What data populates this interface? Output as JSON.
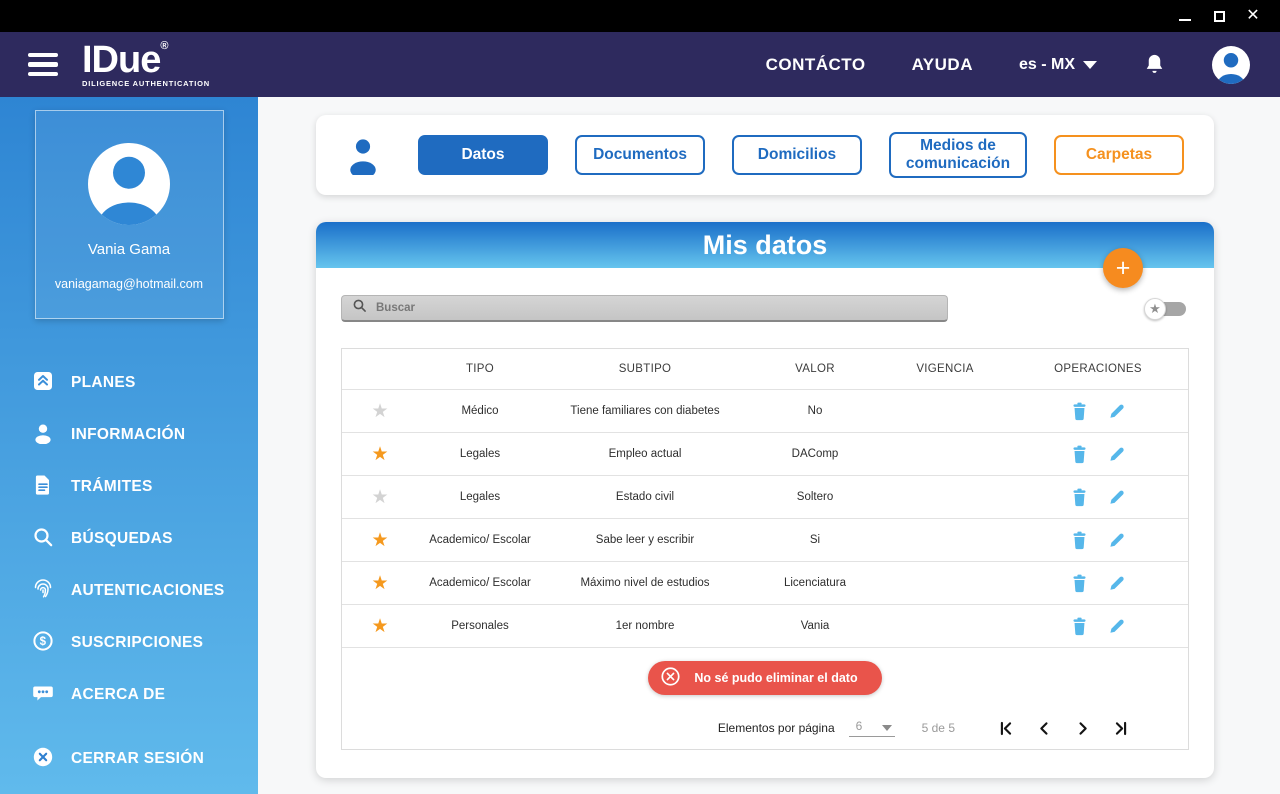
{
  "colors": {
    "header_bg": "#2e2a5e",
    "sidebar_top": "#2e85d3",
    "sidebar_bottom": "#60baec",
    "primary_blue": "#1f6bc0",
    "accent_orange": "#f5911e",
    "operation_icon_blue": "#56b7ea",
    "toast_red": "#e9544b",
    "panel_header_top": "#1a6fc9",
    "panel_header_bottom": "#66c5ee"
  },
  "header": {
    "logo": {
      "title": "IDue",
      "registered_mark": "®",
      "subtitle": "DILIGENCE AUTHENTICATION"
    },
    "nav": {
      "contacto": "CONTÁCTO",
      "ayuda": "AYUDA"
    },
    "language": {
      "value": "es - MX"
    },
    "icons": {
      "menu": "hamburger-icon",
      "notifications": "bell-icon",
      "profile": "avatar"
    }
  },
  "sidebar": {
    "user": {
      "name": "Vania Gama",
      "email": "vaniagamag@hotmail.com"
    },
    "items": [
      {
        "label": "PLANES",
        "icon": "plans-icon"
      },
      {
        "label": "INFORMACIÓN",
        "icon": "person-icon"
      },
      {
        "label": "TRÁMITES",
        "icon": "document-icon"
      },
      {
        "label": "BÚSQUEDAS",
        "icon": "search-icon"
      },
      {
        "label": "AUTENTICACIONES",
        "icon": "fingerprint-icon"
      },
      {
        "label": "SUSCRIPCIONES",
        "icon": "dollar-icon"
      },
      {
        "label": "ACERCA DE",
        "icon": "chat-icon"
      }
    ],
    "logout": {
      "label": "CERRAR SESIÓN",
      "icon": "x-circle-icon"
    }
  },
  "tabs": {
    "items": [
      {
        "label": "Datos",
        "variant": "filled",
        "active": true
      },
      {
        "label": "Documentos",
        "variant": "outline-blue",
        "active": false
      },
      {
        "label": "Domicilios",
        "variant": "outline-blue",
        "active": false
      },
      {
        "label": "Medios de comunicación",
        "variant": "outline-blue",
        "active": false
      },
      {
        "label": "Carpetas",
        "variant": "outline-orange",
        "active": false
      }
    ]
  },
  "panel": {
    "title": "Mis datos",
    "add_button_label": "+",
    "search": {
      "placeholder": "Buscar"
    },
    "favorites_toggle": {
      "state": "off",
      "icon": "star-icon"
    },
    "table": {
      "headers": [
        "TIPO",
        "SUBTIPO",
        "VALOR",
        "VIGENCIA",
        "OPERACIONES"
      ],
      "star_glyph": "★",
      "rows": [
        {
          "favorite": false,
          "tipo": "Médico",
          "subtipo": "Tiene familiares con diabetes",
          "valor": "No",
          "vigencia": ""
        },
        {
          "favorite": true,
          "tipo": "Legales",
          "subtipo": "Empleo actual",
          "valor": "DAComp",
          "vigencia": ""
        },
        {
          "favorite": false,
          "tipo": "Legales",
          "subtipo": "Estado civil",
          "valor": "Soltero",
          "vigencia": ""
        },
        {
          "favorite": true,
          "tipo": "Academico/ Escolar",
          "subtipo": "Sabe leer y escribir",
          "valor": "Si",
          "vigencia": ""
        },
        {
          "favorite": true,
          "tipo": "Academico/ Escolar",
          "subtipo": "Máximo nivel de estudios",
          "valor": "Licenciatura",
          "vigencia": ""
        },
        {
          "favorite": true,
          "tipo": "Personales",
          "subtipo": "1er nombre",
          "valor": "Vania",
          "vigencia": ""
        }
      ]
    },
    "toast": {
      "message": "No sé pudo eliminar el dato",
      "icon": "x-circle-icon"
    },
    "pagination": {
      "items_per_page_label": "Elementos por página",
      "items_per_page_value": "6",
      "range_text": "5 de 5",
      "controls": [
        "first-page",
        "previous-page",
        "next-page",
        "last-page"
      ]
    }
  }
}
